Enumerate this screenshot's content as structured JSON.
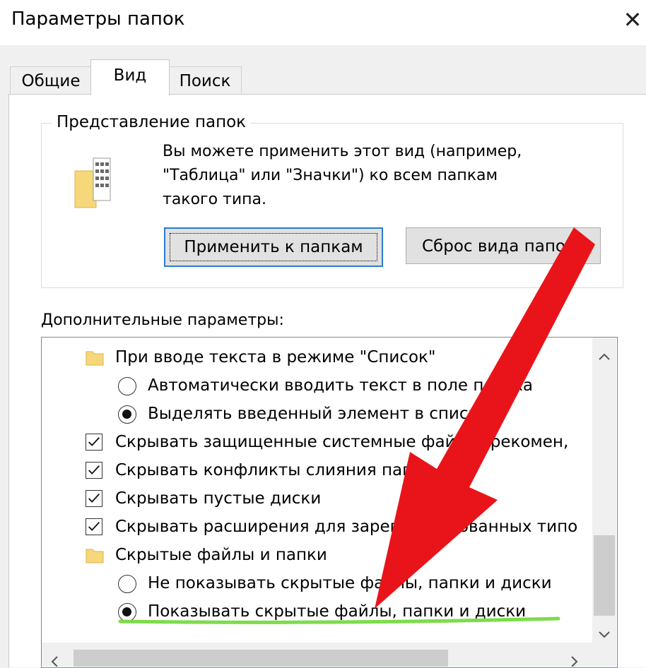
{
  "window": {
    "title": "Параметры папок",
    "close_glyph": "✕"
  },
  "tabs": [
    {
      "label": "Общие",
      "active": false
    },
    {
      "label": "Вид",
      "active": true
    },
    {
      "label": "Поиск",
      "active": false
    }
  ],
  "folder_views": {
    "legend": "Представление папок",
    "icon": "folder-grid-icon",
    "description_lines": [
      "Вы можете применить этот вид (например,",
      "\"Таблица\" или \"Значки\") ко всем папкам",
      "такого типа."
    ],
    "apply_button": "Применить к папкам",
    "reset_button": "Сброс вида папок"
  },
  "advanced": {
    "label": "Дополнительные параметры:",
    "items": [
      {
        "type": "folder",
        "label": "При вводе текста в режиме \"Список\""
      },
      {
        "type": "radio",
        "checked": false,
        "label": "Автоматически вводить текст в поле поиска"
      },
      {
        "type": "radio",
        "checked": true,
        "label": "Выделять введенный элемент в списке"
      },
      {
        "type": "checkbox",
        "checked": true,
        "label": "Скрывать защищенные системные файлы (рекомен,"
      },
      {
        "type": "checkbox",
        "checked": true,
        "label": "Скрывать конфликты слияния папок"
      },
      {
        "type": "checkbox",
        "checked": true,
        "label": "Скрывать пустые диски"
      },
      {
        "type": "checkbox",
        "checked": true,
        "label": "Скрывать расширения для зарегистрированных типо"
      },
      {
        "type": "folder",
        "label": "Скрытые файлы и папки"
      },
      {
        "type": "radio",
        "checked": false,
        "label": "Не показывать скрытые файлы, папки и диски"
      },
      {
        "type": "radio",
        "checked": true,
        "label": "Показывать скрытые файлы, папки и диски"
      }
    ]
  },
  "colors": {
    "annotation_arrow": "#e8141a",
    "highlight_underline": "#7ddc4a",
    "focus_border": "#2a7bd4",
    "folder_yellow": "#f6d77a"
  }
}
